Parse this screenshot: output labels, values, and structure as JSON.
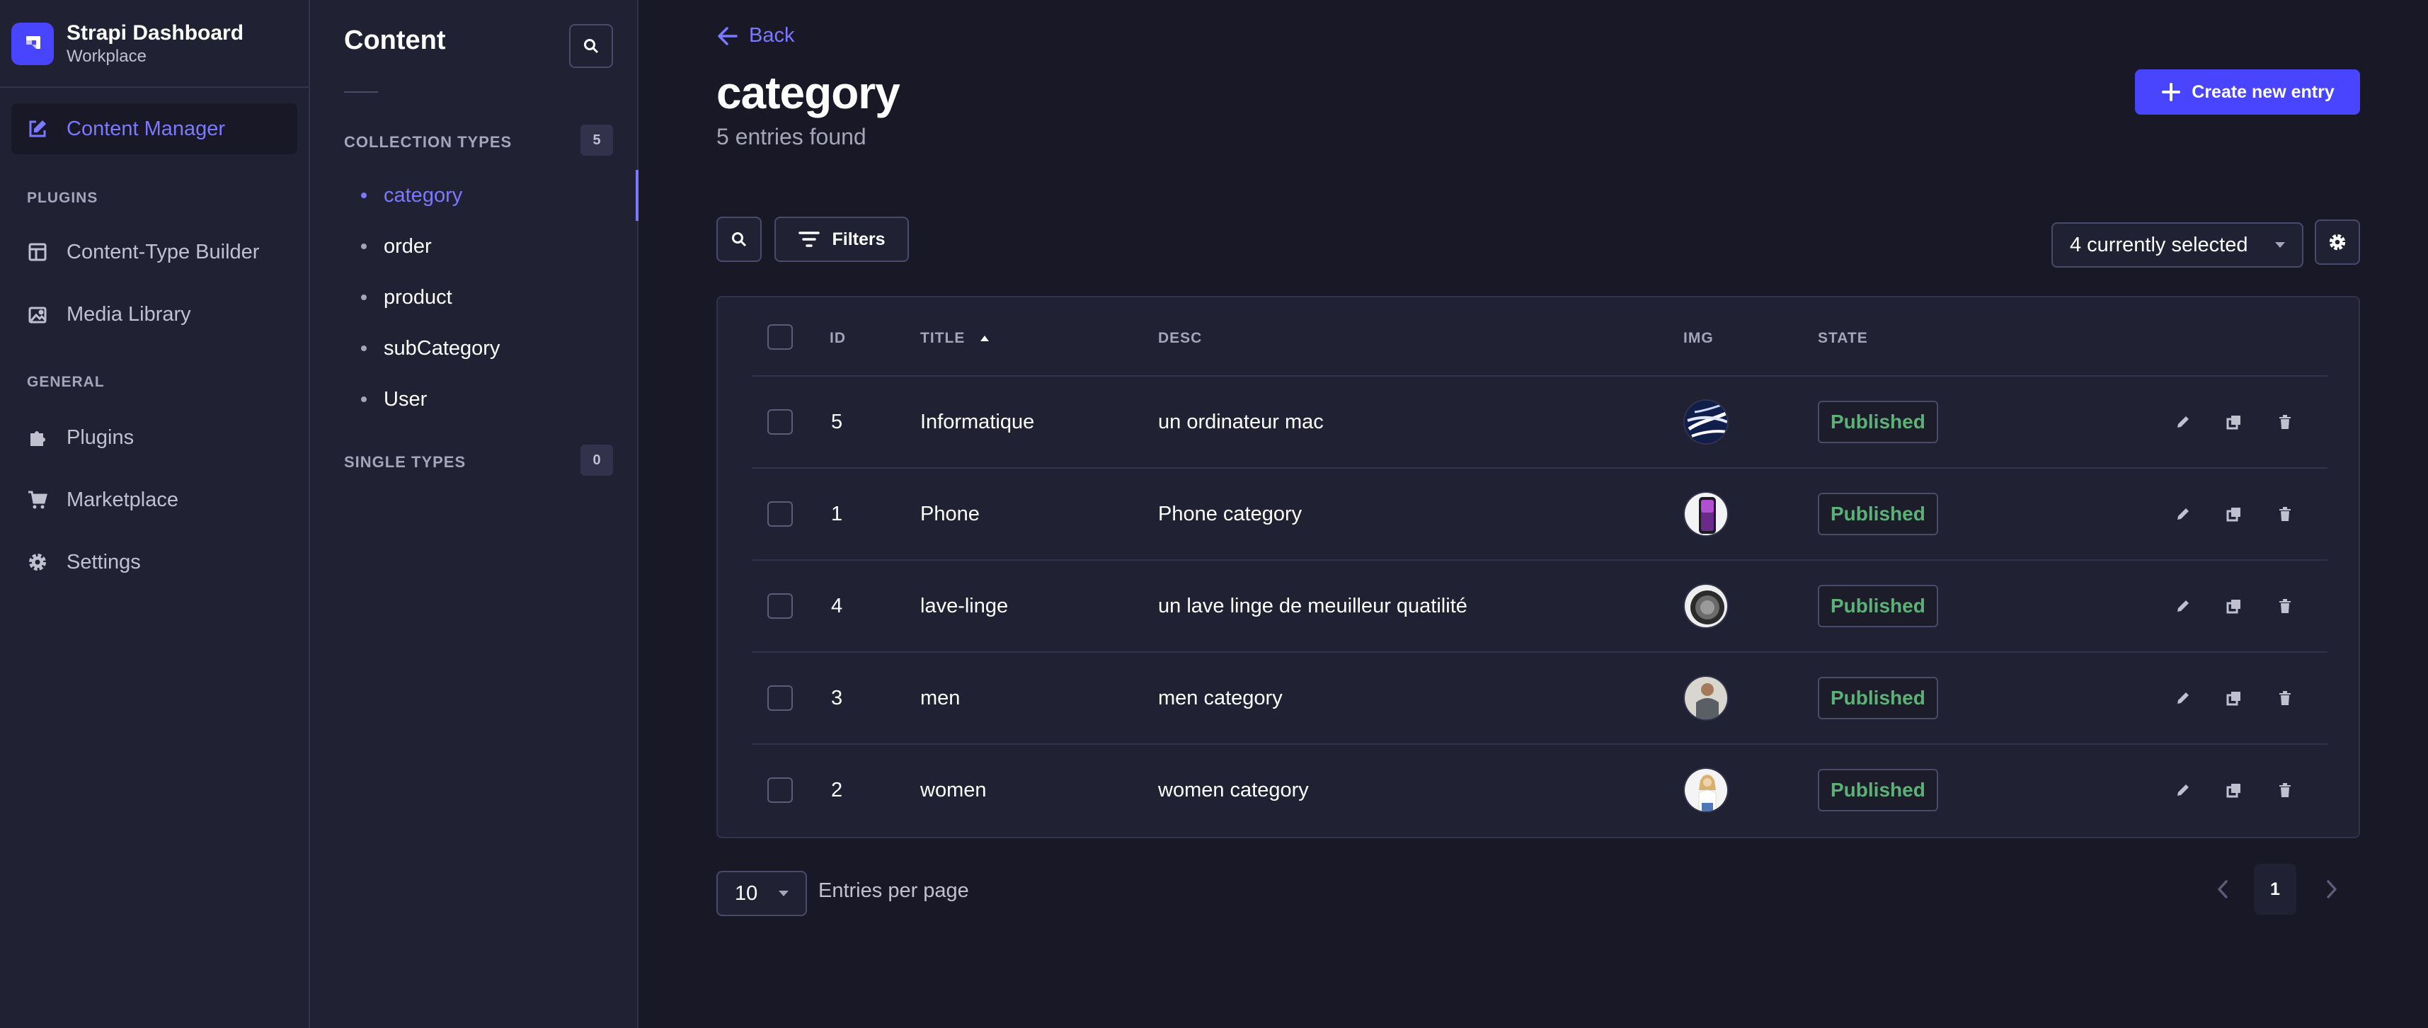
{
  "brand": {
    "name": "Strapi Dashboard",
    "subtitle": "Workplace",
    "color": "#4945ff"
  },
  "main_nav": {
    "content_manager": "Content Manager",
    "plugins_section": "PLUGINS",
    "content_type_builder": "Content-Type Builder",
    "media_library": "Media Library",
    "general_section": "GENERAL",
    "plugins": "Plugins",
    "marketplace": "Marketplace",
    "settings": "Settings"
  },
  "sub_nav": {
    "title": "Content",
    "collection_types_label": "COLLECTION TYPES",
    "collection_types_count": "5",
    "collection_types": [
      "category",
      "order",
      "product",
      "subCategory",
      "User"
    ],
    "active_collection": "category",
    "single_types_label": "SINGLE TYPES",
    "single_types_count": "0"
  },
  "header": {
    "back": "Back",
    "title": "category",
    "subtitle": "5 entries found",
    "create_button": "Create new entry"
  },
  "toolbar": {
    "filters": "Filters",
    "columns_select": "4 currently selected"
  },
  "table": {
    "columns": {
      "id": "ID",
      "title": "TITLE",
      "desc": "DESC",
      "img": "IMG",
      "state": "STATE"
    },
    "sort": {
      "column": "title",
      "direction": "asc"
    },
    "rows": [
      {
        "id": "5",
        "title": "Informatique",
        "desc": "un ordinateur mac",
        "img": "apple-logo-thumbnail",
        "state": "Published"
      },
      {
        "id": "1",
        "title": "Phone",
        "desc": "Phone category",
        "img": "phone-thumbnail",
        "state": "Published"
      },
      {
        "id": "4",
        "title": "lave-linge",
        "desc": "un lave linge de meuilleur quatilité",
        "img": "washing-machine-thumbnail",
        "state": "Published"
      },
      {
        "id": "3",
        "title": "men",
        "desc": "men category",
        "img": "man-photo-thumbnail",
        "state": "Published"
      },
      {
        "id": "2",
        "title": "women",
        "desc": "women category",
        "img": "woman-photo-thumbnail",
        "state": "Published"
      }
    ]
  },
  "pagination": {
    "per_page": "10",
    "per_page_label": "Entries per page",
    "current_page": "1"
  },
  "colors": {
    "background": "#181826",
    "panel": "#212134",
    "accent": "#7b79ff",
    "primary": "#4945ff",
    "published": "#5cb176"
  }
}
